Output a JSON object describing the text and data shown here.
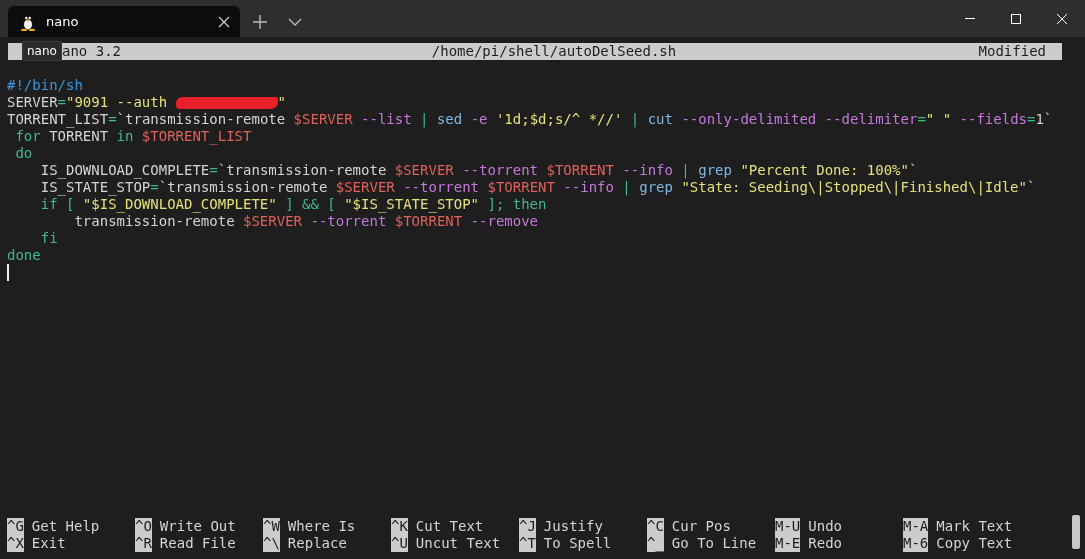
{
  "tab": {
    "title": "nano",
    "selected": true
  },
  "tooltip": "nano",
  "header": {
    "version": "ano 3.2",
    "file": "/home/pi/shell/autoDelSeed.sh",
    "status": "Modified"
  },
  "code": [
    [
      {
        "kind": "comment",
        "text": "#!/bin/sh"
      }
    ],
    [
      {
        "kind": "plain",
        "text": "SERVER"
      },
      {
        "kind": "op",
        "text": "="
      },
      {
        "kind": "string",
        "text": "\"9091 --auth "
      },
      {
        "kind": "redaction"
      },
      {
        "kind": "string",
        "text": "\""
      }
    ],
    [
      {
        "kind": "plain",
        "text": "TORRENT_LIST"
      },
      {
        "kind": "op",
        "text": "="
      },
      {
        "kind": "plain",
        "text": "`transmission-remote "
      },
      {
        "kind": "var",
        "text": "$SERVER"
      },
      {
        "kind": "option",
        "text": " --list"
      },
      {
        "kind": "op",
        "text": " |"
      },
      {
        "kind": "command",
        "text": " sed"
      },
      {
        "kind": "option",
        "text": " -e"
      },
      {
        "kind": "string",
        "text": " '1d;$d;s/^ *//'"
      },
      {
        "kind": "op",
        "text": " |"
      },
      {
        "kind": "command",
        "text": " cut"
      },
      {
        "kind": "option",
        "text": " --only-delimited"
      },
      {
        "kind": "option",
        "text": " --delimiter"
      },
      {
        "kind": "op",
        "text": "="
      },
      {
        "kind": "string",
        "text": "\" \""
      },
      {
        "kind": "option",
        "text": " --fields"
      },
      {
        "kind": "op",
        "text": "="
      },
      {
        "kind": "plain",
        "text": "1`"
      }
    ],
    [
      {
        "kind": "keyword",
        "text": " for"
      },
      {
        "kind": "plain",
        "text": " TORRENT "
      },
      {
        "kind": "keyword",
        "text": "in"
      },
      {
        "kind": "var",
        "text": " $TORRENT_LIST"
      }
    ],
    [
      {
        "kind": "keyword",
        "text": " do"
      }
    ],
    [
      {
        "kind": "plain",
        "text": "    IS_DOWNLOAD_COMPLETE"
      },
      {
        "kind": "op",
        "text": "="
      },
      {
        "kind": "plain",
        "text": "`transmission-remote "
      },
      {
        "kind": "var",
        "text": "$SERVER"
      },
      {
        "kind": "option",
        "text": " --torrent"
      },
      {
        "kind": "var",
        "text": " $TORRENT"
      },
      {
        "kind": "option",
        "text": " --info"
      },
      {
        "kind": "op",
        "text": " |"
      },
      {
        "kind": "command",
        "text": " grep"
      },
      {
        "kind": "string",
        "text": " \"Percent Done: 100%\""
      },
      {
        "kind": "plain",
        "text": "`"
      }
    ],
    [
      {
        "kind": "plain",
        "text": "    IS_STATE_STOP"
      },
      {
        "kind": "op",
        "text": "="
      },
      {
        "kind": "plain",
        "text": "`transmission-remote "
      },
      {
        "kind": "var",
        "text": "$SERVER"
      },
      {
        "kind": "option",
        "text": " --torrent"
      },
      {
        "kind": "var",
        "text": " $TORRENT"
      },
      {
        "kind": "option",
        "text": " --info"
      },
      {
        "kind": "op",
        "text": " |"
      },
      {
        "kind": "command",
        "text": " grep"
      },
      {
        "kind": "string",
        "text": " \"State: Seeding\\|Stopped\\|Finished\\|Idle\""
      },
      {
        "kind": "plain",
        "text": "`"
      }
    ],
    [
      {
        "kind": "keyword",
        "text": "    if [ "
      },
      {
        "kind": "string",
        "text": "\"$IS_DOWNLOAD_COMPLETE\""
      },
      {
        "kind": "keyword",
        "text": " ] && [ "
      },
      {
        "kind": "string",
        "text": "\"$IS_STATE_STOP\""
      },
      {
        "kind": "keyword",
        "text": " ]; then"
      }
    ],
    [
      {
        "kind": "plain",
        "text": "        transmission-remote "
      },
      {
        "kind": "var",
        "text": "$SERVER"
      },
      {
        "kind": "option",
        "text": " --torrent"
      },
      {
        "kind": "var",
        "text": " $TORRENT"
      },
      {
        "kind": "option",
        "text": " --remove"
      }
    ],
    [
      {
        "kind": "keyword",
        "text": "    fi"
      }
    ],
    [
      {
        "kind": "keyword",
        "text": "done"
      }
    ]
  ],
  "shortcuts": [
    [
      {
        "key": "^G",
        "label": "Get Help"
      },
      {
        "key": "^O",
        "label": "Write Out"
      },
      {
        "key": "^W",
        "label": "Where Is"
      },
      {
        "key": "^K",
        "label": "Cut Text"
      },
      {
        "key": "^J",
        "label": "Justify"
      },
      {
        "key": "^C",
        "label": "Cur Pos"
      },
      {
        "key": "M-U",
        "label": "Undo"
      },
      {
        "key": "M-A",
        "label": "Mark Text"
      }
    ],
    [
      {
        "key": "^X",
        "label": "Exit"
      },
      {
        "key": "^R",
        "label": "Read File"
      },
      {
        "key": "^\\",
        "label": "Replace"
      },
      {
        "key": "^U",
        "label": "Uncut Text"
      },
      {
        "key": "^T",
        "label": "To Spell"
      },
      {
        "key": "^_",
        "label": "Go To Line"
      },
      {
        "key": "M-E",
        "label": "Redo"
      },
      {
        "key": "M-6",
        "label": "Copy Text"
      }
    ]
  ]
}
